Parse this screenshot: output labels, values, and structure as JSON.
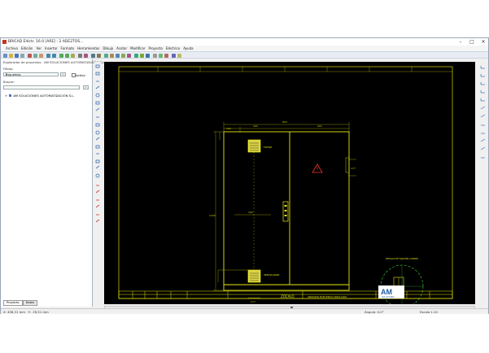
{
  "window": {
    "title": "BRICAD Eléctr. 16.0 [ARE] - 2 ADE2TOS...",
    "controls": [
      "–",
      "□",
      "✕"
    ]
  },
  "menu": [
    "Archivo",
    "Edición",
    "Ver",
    "Insertar",
    "Formato",
    "Herramientas",
    "Dibujo",
    "Acotar",
    "Modificar",
    "Proyecto",
    "Eléctrico",
    "Ayuda"
  ],
  "panel": {
    "title": "Explorador de proyectos · AM SOLUCIONES AUTOMATIZACIÓN S.L.",
    "filter_label": "Filtros:",
    "combo_value": "Esquemas",
    "dots_label": "...",
    "active_label": "Activo",
    "search_label": "Buscar:",
    "search_btn": "…",
    "tree_item": "AM SOLUCIONES AUTOMATIZACIÓN S.L.",
    "tabs": [
      "Proyecto",
      "Datos"
    ]
  },
  "drawing": {
    "dim_total": "800",
    "dim_left": "400",
    "dim_right": "400",
    "dim_top_small": "100",
    "dim_door_left": "177",
    "dim_side": "1200",
    "dim_mid": "300",
    "dim_fan_w": "177",
    "fan_top_label": "FILTRO",
    "fan_bottom_label": "VENTILADOR",
    "plinth_label": "ZÓCALO",
    "detail_label": "DETALLE DE FIJACIÓN A PARED"
  },
  "titleblock": {
    "project": "ARMARIO ELÉCTRICO 800x1200",
    "company": "AM",
    "company_sub": "SOLUCIONES"
  },
  "status": {
    "coords": "X: 458,31 mm · Y: -78,51 mm",
    "mid": "Ángulo: 0,0°",
    "right": "Escala 1:10"
  },
  "colors": {
    "canvas": "#000000",
    "cad_line": "#e8e812",
    "cad_frame": "#ffff00",
    "cad_dim": "#c9c900",
    "accent": "#1f5ba8"
  }
}
